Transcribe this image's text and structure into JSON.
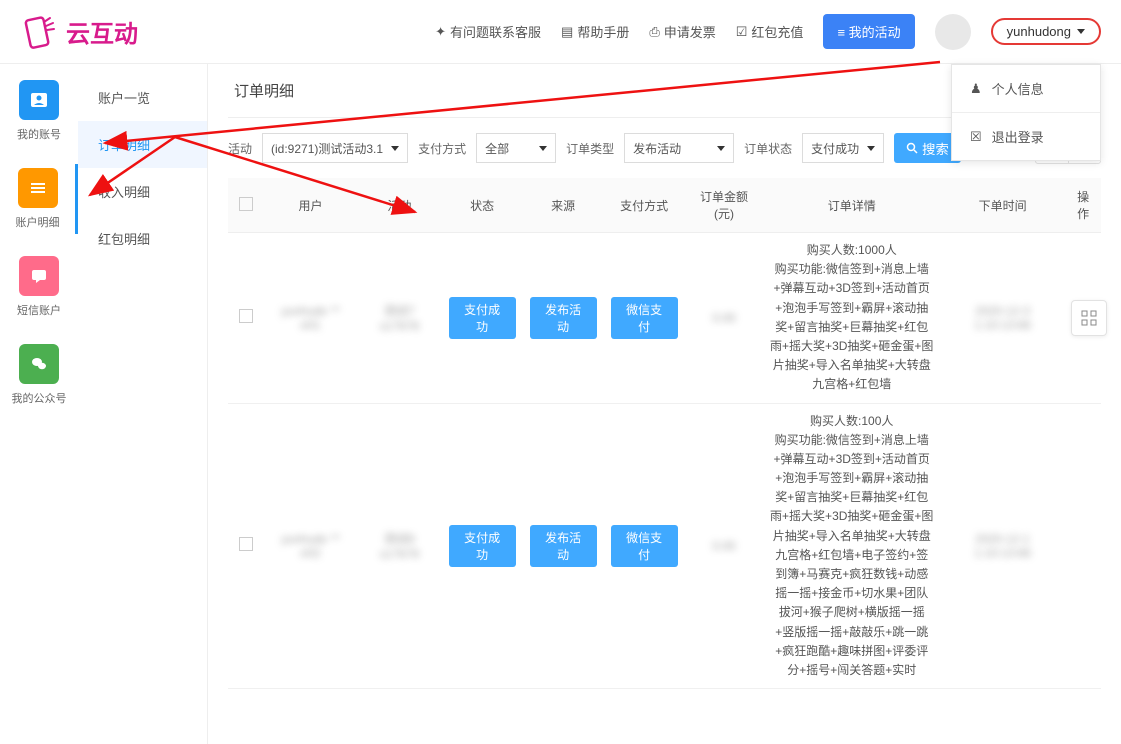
{
  "logo_text": "云互动",
  "header": {
    "contact": "有问题联系客服",
    "help": "帮助手册",
    "invoice": "申请发票",
    "redpacket": "红包充值",
    "my_activity": "我的活动",
    "username": "yunhudong"
  },
  "dropdown": {
    "profile": "个人信息",
    "logout": "退出登录"
  },
  "icon_sidebar": [
    {
      "label": "我的账号"
    },
    {
      "label": "账户明细"
    },
    {
      "label": "短信账户"
    },
    {
      "label": "我的公众号"
    }
  ],
  "sub_sidebar": [
    {
      "label": "账户一览"
    },
    {
      "label": "订单明细"
    },
    {
      "label": "收入明细"
    },
    {
      "label": "红包明细"
    }
  ],
  "page_title": "订单明细",
  "filters": {
    "activity_label": "活动",
    "activity_value": "(id:9271)测试活动3.1",
    "pay_method_label": "支付方式",
    "pay_method_value": "全部",
    "order_type_label": "订单类型",
    "order_type_value": "发布活动",
    "order_status_label": "订单状态",
    "order_status_value": "支付成功",
    "search_label": "搜索"
  },
  "table": {
    "headers": [
      "用户",
      "活动",
      "状态",
      "来源",
      "支付方式",
      "订单金额(元)",
      "订单详情",
      "下单时间",
      "操作"
    ],
    "rows": [
      {
        "user": "yunhude ** e01",
        "activity": "测试7 s17678",
        "status": "支付成功",
        "source": "发布活动",
        "pay_method": "微信支付",
        "amount": "0.00",
        "details": "购买人数:1000人\n购买功能:微信签到+消息上墙+弹幕互动+3D签到+活动首页+泡泡手写签到+霸屏+滚动抽奖+留言抽奖+巨幕抽奖+红包雨+摇大奖+3D抽奖+砸金蛋+图片抽奖+导入名单抽奖+大转盘九宫格+红包墙",
        "order_time": "2020-12-3 1:10:13:66"
      },
      {
        "user": "yunhude ** e02",
        "activity": "测试8 s17679",
        "status": "支付成功",
        "source": "发布活动",
        "pay_method": "微信支付",
        "amount": "0.00",
        "details": "购买人数:100人\n购买功能:微信签到+消息上墙+弹幕互动+3D签到+活动首页+泡泡手写签到+霸屏+滚动抽奖+留言抽奖+巨幕抽奖+红包雨+摇大奖+3D抽奖+砸金蛋+图片抽奖+导入名单抽奖+大转盘九宫格+红包墙+电子签约+签到簿+马赛克+疯狂数钱+动感摇一摇+接金币+切水果+团队拔河+猴子爬树+横版摇一摇+竖版摇一摇+敲敲乐+跳一跳+疯狂跑酷+趣味拼图+评委评分+摇号+闯关答题+实时",
        "order_time": "2020-12-1 1:10:13:66"
      }
    ]
  }
}
